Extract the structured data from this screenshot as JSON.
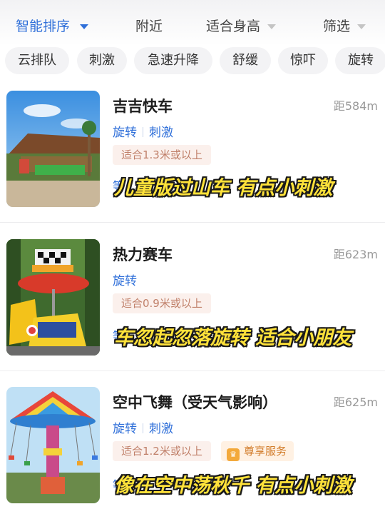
{
  "sort_bar": {
    "smart_sort": "智能排序",
    "nearby": "附近",
    "height_fit": "适合身高",
    "filter": "筛选"
  },
  "chips": [
    "云排队",
    "刺激",
    "急速升降",
    "舒缓",
    "惊吓",
    "旋转"
  ],
  "rides": [
    {
      "name": "吉吉快车",
      "distance": "距584m",
      "tags": [
        "旋转",
        "刺激"
      ],
      "height": "适合1.3米或以上",
      "caption": "儿童版过山车 有点小刺激"
    },
    {
      "name": "热力赛车",
      "distance": "距623m",
      "tags": [
        "旋转"
      ],
      "height": "适合0.9米或以上",
      "caption": "车忽起忽落旋转 适合小朋友"
    },
    {
      "name": "空中飞舞（受天气影响）",
      "distance": "距625m",
      "tags": [
        "旋转",
        "刺激"
      ],
      "height": "适合1.2米或以上",
      "service": "尊享服务",
      "caption": "像在空中荡秋千 有点小刺激"
    }
  ],
  "partial_label": "等",
  "colors": {
    "accent": "#2f6fd9",
    "caption_fill": "#ffe23a",
    "height_badge_bg": "#fbf0ec",
    "service_badge_bg": "#fff1e3"
  },
  "icons": {
    "sort_dropdown": "triangle-down-icon",
    "service_badge": "crown-icon"
  }
}
